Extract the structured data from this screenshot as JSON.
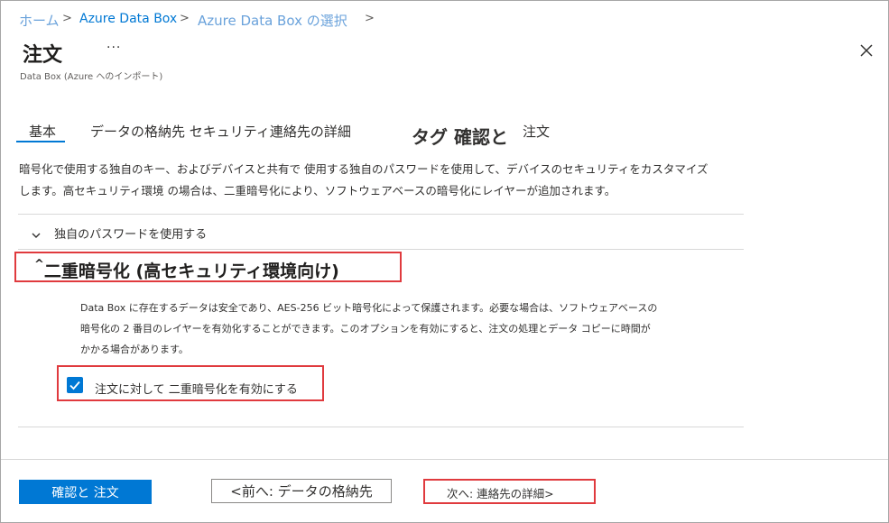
{
  "breadcrumb": {
    "items": [
      "ホーム",
      "Azure Data Box",
      "Azure Data Box の選択"
    ],
    "separator": ">"
  },
  "header": {
    "title": "注文",
    "more": "···",
    "subtitle": "Data Box (Azure へのインポート)"
  },
  "tabs": [
    {
      "label": "基本",
      "active": true
    },
    {
      "label": "データの格納先 セキュリティ連絡先の詳細"
    },
    {
      "label": "タグ 確認と"
    },
    {
      "label": "注文"
    }
  ],
  "description": {
    "line1": "暗号化で使用する独自のキー、およびデバイスと共有で 使用する独自のパスワードを使用して、デバイスのセキュリティをカスタマイズ",
    "line2": "します。高セキュリティ環境 の場合は、二重暗号化により、ソフトウェアベースの暗号化にレイヤーが追加されます。"
  },
  "password_section": {
    "label": "独自のパスワードを使用する"
  },
  "double_encryption": {
    "caret": "^",
    "heading": "二重暗号化 (高セキュリティ環境向け)",
    "body_line1": "Data Box に存在するデータは安全であり、AES-256 ビット暗号化によって保護されます。必要な場合は、ソフトウェアベースの",
    "body_line2": "暗号化の 2 番目のレイヤーを有効化することができます。このオプションを有効にすると、注文の処理とデータ コピーに時間が",
    "body_line3": "かかる場合があります。",
    "checkbox_label": "注文に対して 二重暗号化を有効にする",
    "checkbox_checked": true
  },
  "footer": {
    "primary": "確認と 注文",
    "previous": "<前へ: データの格納先",
    "next": "次へ: 連絡先の詳細>"
  },
  "colors": {
    "accent": "#0078d4",
    "highlight": "#e03a3e"
  }
}
